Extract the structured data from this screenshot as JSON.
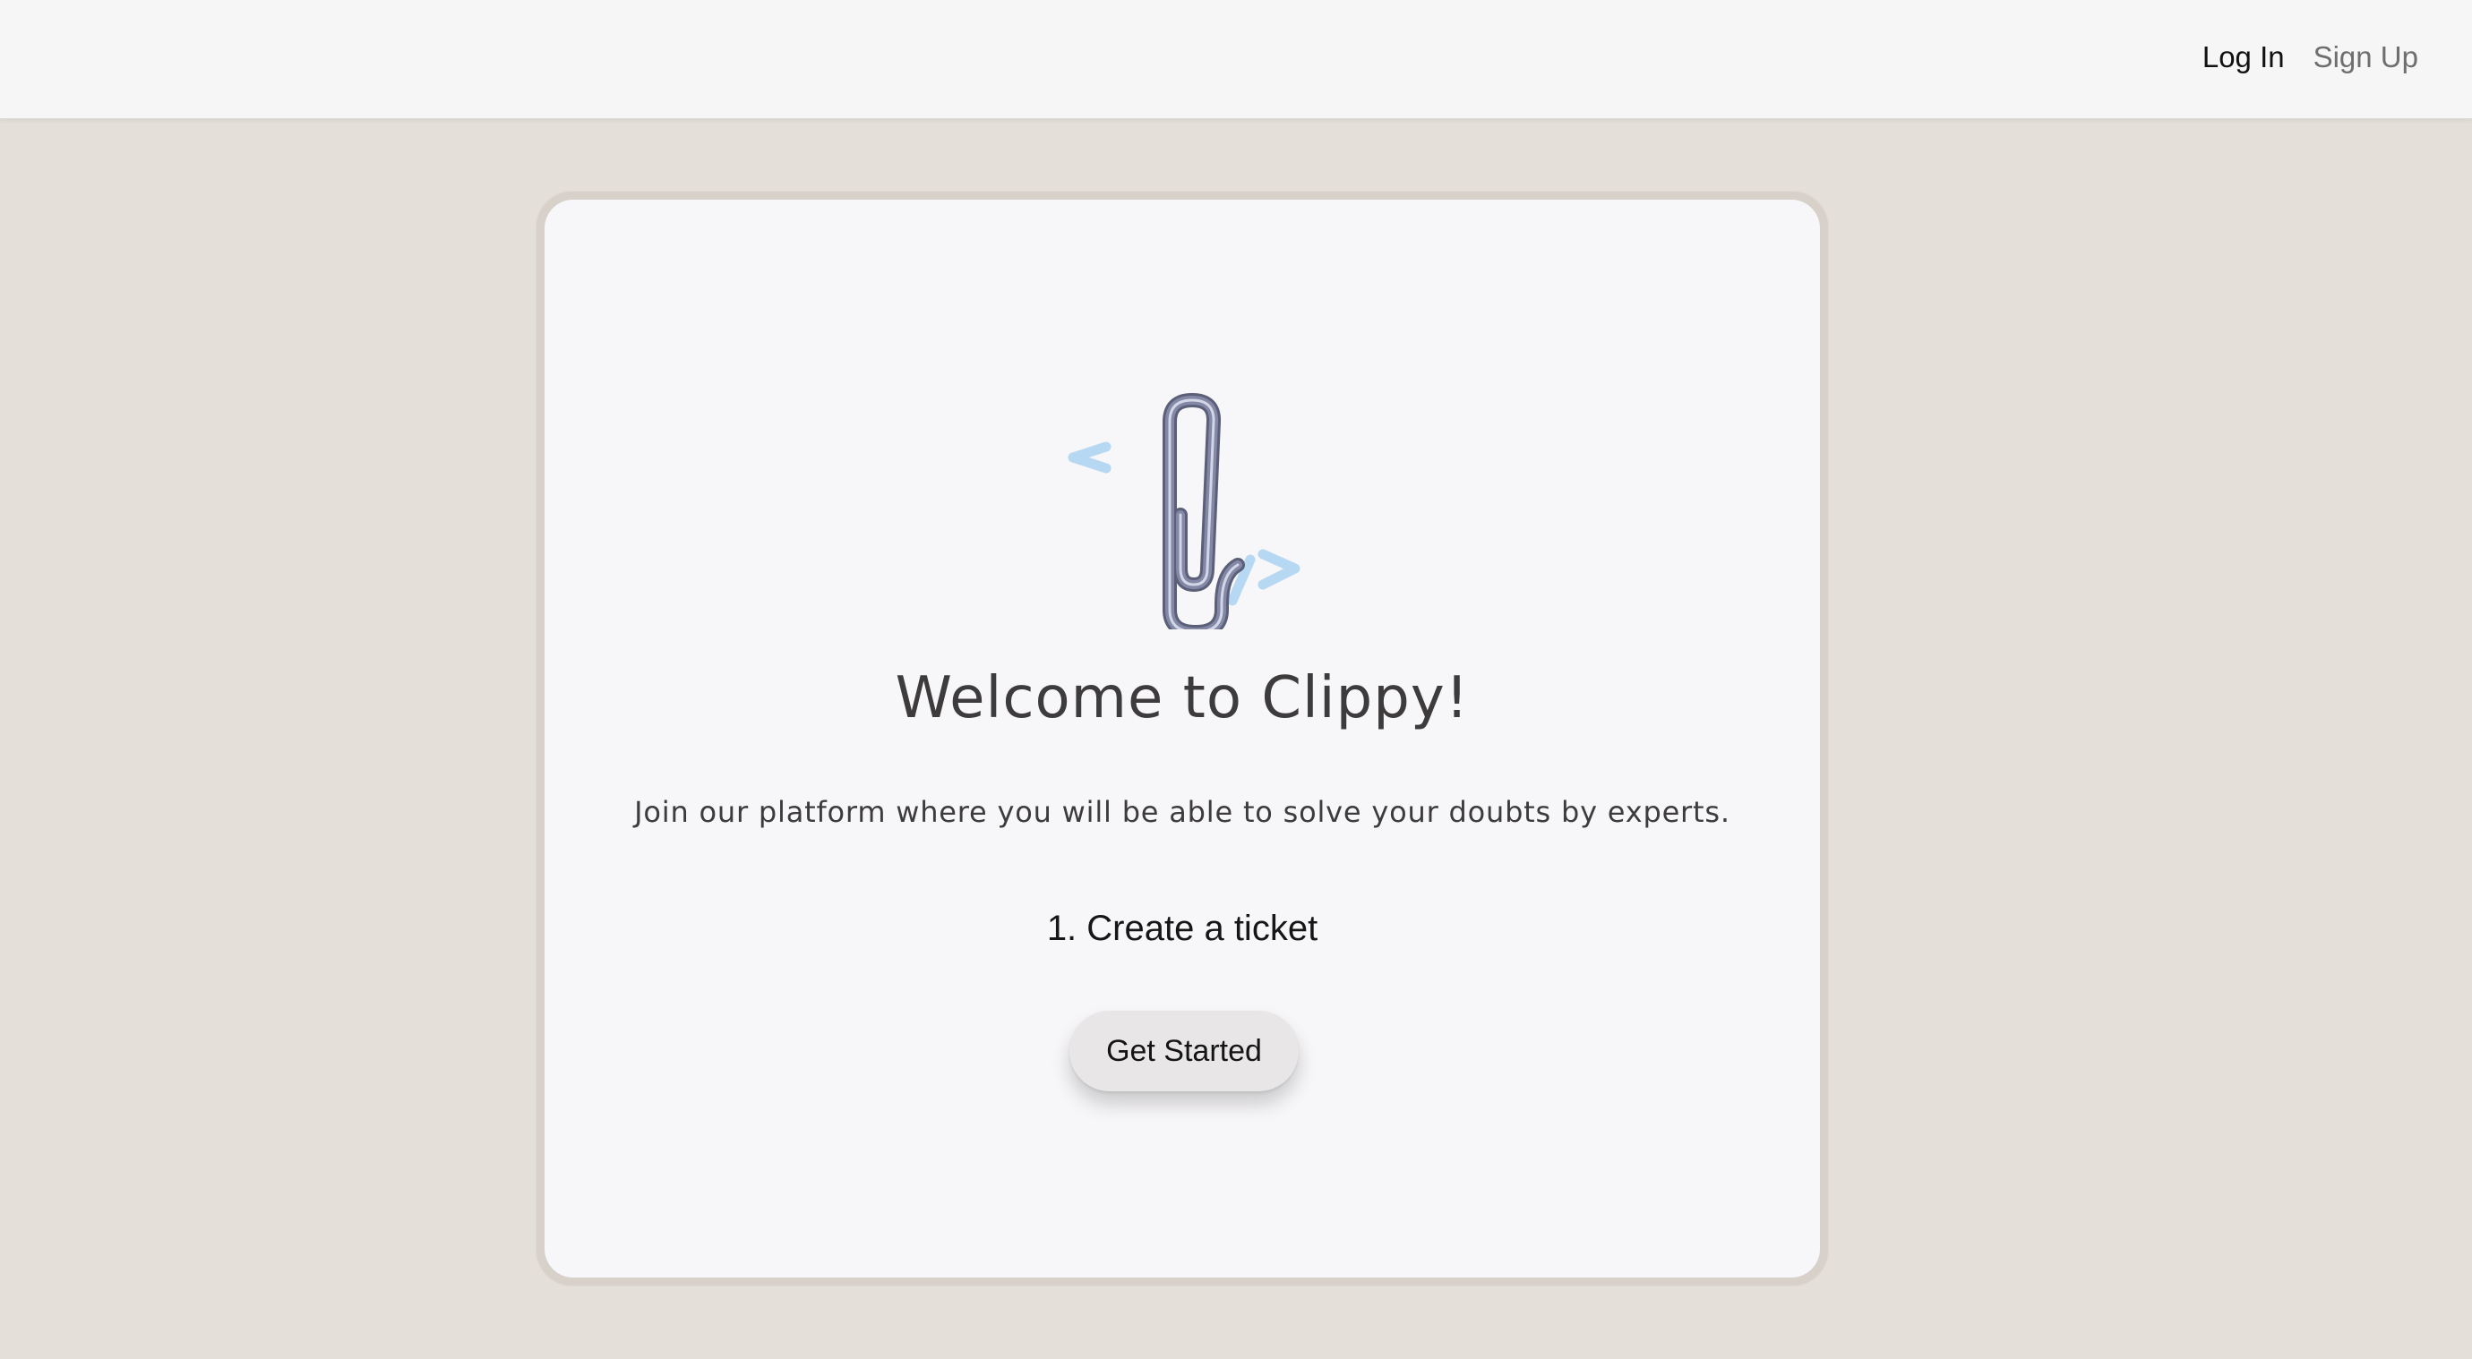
{
  "nav": {
    "login_label": "Log In",
    "signup_label": "Sign Up"
  },
  "hero": {
    "logo_icon": "paperclip-code-icon",
    "title": "Welcome to Clippy!",
    "subtitle": "Join our platform where you will be able to solve your doubts by experts.",
    "step": "1. Create a ticket",
    "cta_label": "Get Started"
  },
  "colors": {
    "background": "#e4dfd9",
    "navbar": "#f6f6f6",
    "card": "#f7f6f8",
    "card_border": "#d8d1ca",
    "code_brackets": "#b7d8f2",
    "paperclip": "#6f7490",
    "button": "#e8e6e7"
  }
}
